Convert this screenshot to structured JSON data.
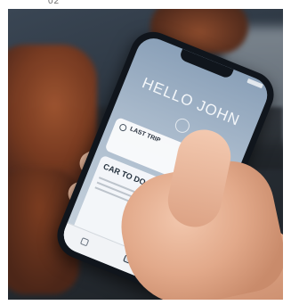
{
  "image": {
    "top_crop_text": "02"
  },
  "phone_app": {
    "greeting": "HELLO JOHN",
    "last_trip_card": {
      "title": "LAST TRIP",
      "meta": "",
      "subtitle": ""
    },
    "car_to_door_section": {
      "title": "CAR TO DOOR",
      "meta": "",
      "options": [
        "",
        "",
        ""
      ]
    },
    "tab_bar": {
      "tabs": [
        "",
        "",
        ""
      ]
    }
  },
  "colors": {
    "screen_top": "#8aa0b8",
    "card_bg": "#ffffff",
    "accent_text": "#23303d",
    "skin": "#e2a98a",
    "chair_leather": "#7a3a1f"
  },
  "icons": [
    "trip-icon",
    "avatar-icon",
    "home-tab-icon",
    "car-tab-icon",
    "account-tab-icon"
  ]
}
